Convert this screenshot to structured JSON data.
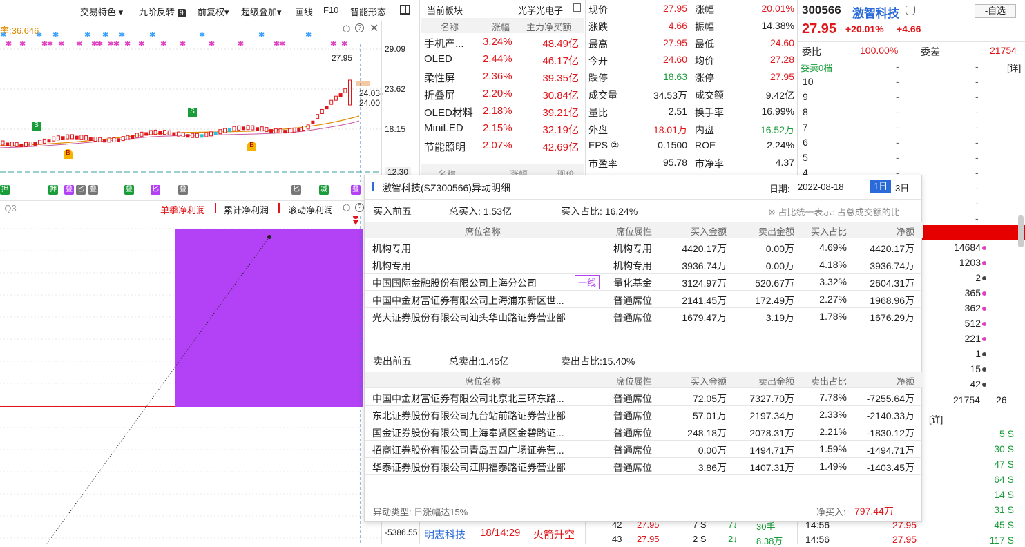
{
  "toolbar": {
    "items": [
      "交易特色",
      "九阶反转",
      "9",
      "前复权",
      "超级叠加",
      "画线",
      "F10",
      "智能形态"
    ]
  },
  "chart": {
    "indicator_text": "率:36.646",
    "price_labels": [
      "29.09",
      "23.62",
      "18.15",
      "12.30"
    ],
    "high_label": "27.95",
    "range_label": "24.03-24.00",
    "b_label": "B",
    "s_label": "S",
    "tags": [
      "押",
      "押",
      "叠",
      "匕",
      "叠",
      "叠",
      "匕",
      "叠",
      "匕",
      "减",
      "叠"
    ]
  },
  "profit": {
    "quarter": "-Q3",
    "tabs": [
      "单季净利润",
      "累计净利润",
      "滚动净利润"
    ],
    "bottom_value": "-5386.55"
  },
  "sector": {
    "title": "当前板块",
    "current": "光学光电子",
    "col_name": "名称",
    "col_change": "涨幅",
    "col_flow": "主力净买额",
    "rows": [
      {
        "name": "手机产...",
        "change": "3.24%",
        "flow": "48.49亿"
      },
      {
        "name": "OLED",
        "change": "2.44%",
        "flow": "46.17亿"
      },
      {
        "name": "柔性屏",
        "change": "2.36%",
        "flow": "39.35亿"
      },
      {
        "name": "折叠屏",
        "change": "2.20%",
        "flow": "30.84亿"
      },
      {
        "name": "OLED材料",
        "change": "2.18%",
        "flow": "39.21亿"
      },
      {
        "name": "MiniLED",
        "change": "2.15%",
        "flow": "32.19亿"
      },
      {
        "name": "节能照明",
        "change": "2.07%",
        "flow": "42.69亿"
      }
    ],
    "sub_head": [
      "名称",
      "涨幅",
      "现价"
    ]
  },
  "quote": {
    "rows": [
      {
        "l1": "现价",
        "v1": "27.95",
        "l2": "涨幅",
        "v2": "20.01%",
        "c1": "red",
        "c2": "red"
      },
      {
        "l1": "涨跌",
        "v1": "4.66",
        "l2": "振幅",
        "v2": "14.38%",
        "c1": "red",
        "c2": ""
      },
      {
        "l1": "最高",
        "v1": "27.95",
        "l2": "最低",
        "v2": "24.60",
        "c1": "red",
        "c2": "red"
      },
      {
        "l1": "今开",
        "v1": "24.60",
        "l2": "均价",
        "v2": "27.28",
        "c1": "red",
        "c2": "red"
      },
      {
        "l1": "跌停",
        "v1": "18.63",
        "l2": "涨停",
        "v2": "27.95",
        "c1": "green",
        "c2": "red"
      },
      {
        "l1": "成交量",
        "v1": "34.53万",
        "l2": "成交额",
        "v2": "9.42亿",
        "c1": "",
        "c2": ""
      },
      {
        "l1": "量比",
        "v1": "2.51",
        "l2": "换手率",
        "v2": "16.99%",
        "c1": "",
        "c2": ""
      },
      {
        "l1": "外盘",
        "v1": "18.01万",
        "l2": "内盘",
        "v2": "16.52万",
        "c1": "red",
        "c2": "green"
      },
      {
        "l1": "EPS ②",
        "v1": "0.1500",
        "l2": "ROE",
        "v2": "2.24%",
        "c1": "",
        "c2": ""
      },
      {
        "l1": "市盈率",
        "v1": "95.78",
        "l2": "市净率",
        "v2": "4.37",
        "c1": "",
        "c2": ""
      }
    ]
  },
  "stock": {
    "code": "300566",
    "name": "激智科技",
    "price": "27.95",
    "pct": "+20.01%",
    "chg": "+4.66",
    "select_btn": "-自选",
    "wb_label": "委比",
    "wb_value": "100.00%",
    "wc_label": "委差",
    "wc_value": "21754",
    "sell_label": "委卖0档",
    "detail": "[详]",
    "levels": [
      "10",
      "9",
      "8",
      "7",
      "6",
      "5",
      "4"
    ],
    "dash": "-"
  },
  "book": {
    "volumes": [
      "14684",
      "1203",
      "2",
      "365",
      "362",
      "512",
      "221",
      "1",
      "15",
      "42"
    ],
    "total": "21754",
    "total2": "26",
    "detail": "[详]",
    "ticks": [
      "5 S",
      "30 S",
      "47 S",
      "64 S",
      "14 S",
      "31 S",
      "45 S",
      "117 S"
    ],
    "time_rows": [
      {
        "t": "14:56",
        "p": "27.95"
      },
      {
        "t": "14:56",
        "p": "27.95"
      }
    ]
  },
  "dialog": {
    "title": "激智科技(SZ300566)异动明细",
    "date_label": "日期:",
    "date": "2022-08-18",
    "btn_1d": "1日",
    "btn_3d": "3日",
    "buy_title": "买入前五",
    "buy_total": "总买入: 1.53亿",
    "buy_ratio": "买入占比: 16.24%",
    "note": "※ 占比统一表示: 占总成交额的比",
    "cols": [
      "席位名称",
      "席位属性",
      "买入金额",
      "卖出金额",
      "买入占比",
      "净额"
    ],
    "cols_sell": [
      "席位名称",
      "席位属性",
      "买入金额",
      "卖出金额",
      "卖出占比",
      "净额"
    ],
    "buy_rows": [
      {
        "name": "机构专用",
        "attr": "机构专用",
        "buy": "4420.17万",
        "sell": "0.00万",
        "ratio": "4.69%",
        "net": "4420.17万",
        "badge": ""
      },
      {
        "name": "机构专用",
        "attr": "机构专用",
        "buy": "3936.74万",
        "sell": "0.00万",
        "ratio": "4.18%",
        "net": "3936.74万",
        "badge": ""
      },
      {
        "name": "中国国际金融股份有限公司上海分公司",
        "attr": "量化基金",
        "buy": "3124.97万",
        "sell": "520.67万",
        "ratio": "3.32%",
        "net": "2604.31万",
        "badge": "一线"
      },
      {
        "name": "中国中金财富证券有限公司上海浦东新区世...",
        "attr": "普通席位",
        "buy": "2141.45万",
        "sell": "172.49万",
        "ratio": "2.27%",
        "net": "1968.96万",
        "badge": ""
      },
      {
        "name": "光大证券股份有限公司汕头华山路证券营业部",
        "attr": "普通席位",
        "buy": "1679.47万",
        "sell": "3.19万",
        "ratio": "1.78%",
        "net": "1676.29万",
        "badge": ""
      }
    ],
    "sell_title": "卖出前五",
    "sell_total": "总卖出:1.45亿",
    "sell_ratio": "卖出占比:15.40%",
    "sell_rows": [
      {
        "name": "中国中金财富证券有限公司北京北三环东路...",
        "attr": "普通席位",
        "buy": "72.05万",
        "sell": "7327.70万",
        "ratio": "7.78%",
        "net": "-7255.64万"
      },
      {
        "name": "东北证券股份有限公司九台站前路证券营业部",
        "attr": "普通席位",
        "buy": "57.01万",
        "sell": "2197.34万",
        "ratio": "2.33%",
        "net": "-2140.33万"
      },
      {
        "name": "国金证券股份有限公司上海奉贤区金碧路证...",
        "attr": "普通席位",
        "buy": "248.18万",
        "sell": "2078.31万",
        "ratio": "2.21%",
        "net": "-1830.12万"
      },
      {
        "name": "招商证券股份有限公司青岛五四广场证券营...",
        "attr": "普通席位",
        "buy": "0.00万",
        "sell": "1494.71万",
        "ratio": "1.59%",
        "net": "-1494.71万"
      },
      {
        "name": "华泰证券股份有限公司江阴福泰路证券营业部",
        "attr": "普通席位",
        "buy": "3.86万",
        "sell": "1407.31万",
        "ratio": "1.49%",
        "net": "-1403.45万"
      }
    ],
    "type_label": "异动类型: 日涨幅达15%",
    "net_label": "净买入:",
    "net_value": "797.44万"
  },
  "bottom": {
    "news_name": "明志科技",
    "news_time": "18/14:29",
    "news_tag": "火箭升空",
    "deals": [
      {
        "n": "42",
        "p": "27.95",
        "v": "7 S",
        "c": "7↓",
        "amt": "30手"
      },
      {
        "n": "43",
        "p": "27.95",
        "v": "2 S",
        "c": "2↓",
        "amt": "8.38万"
      }
    ]
  },
  "colors": {
    "up": "#e0151a",
    "down": "#1a9c3a",
    "purple": "#b341f5",
    "accent": "#2a6bd9"
  }
}
